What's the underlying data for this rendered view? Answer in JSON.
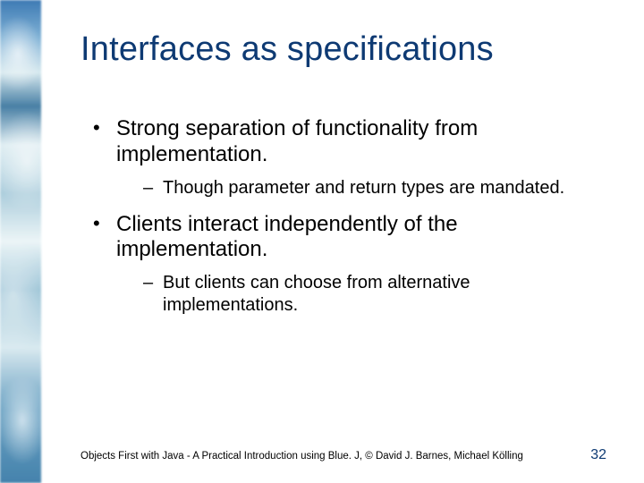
{
  "title": "Interfaces as specifications",
  "bullets": [
    {
      "text": "Strong separation of functionality from implementation.",
      "sub": [
        "Though parameter and return types are mandated."
      ]
    },
    {
      "text": "Clients interact independently of the implementation.",
      "sub": [
        "But clients can choose from alternative implementations."
      ]
    }
  ],
  "footer": "Objects First with Java - A Practical Introduction using Blue. J, © David J. Barnes, Michael Kölling",
  "page_number": "32"
}
